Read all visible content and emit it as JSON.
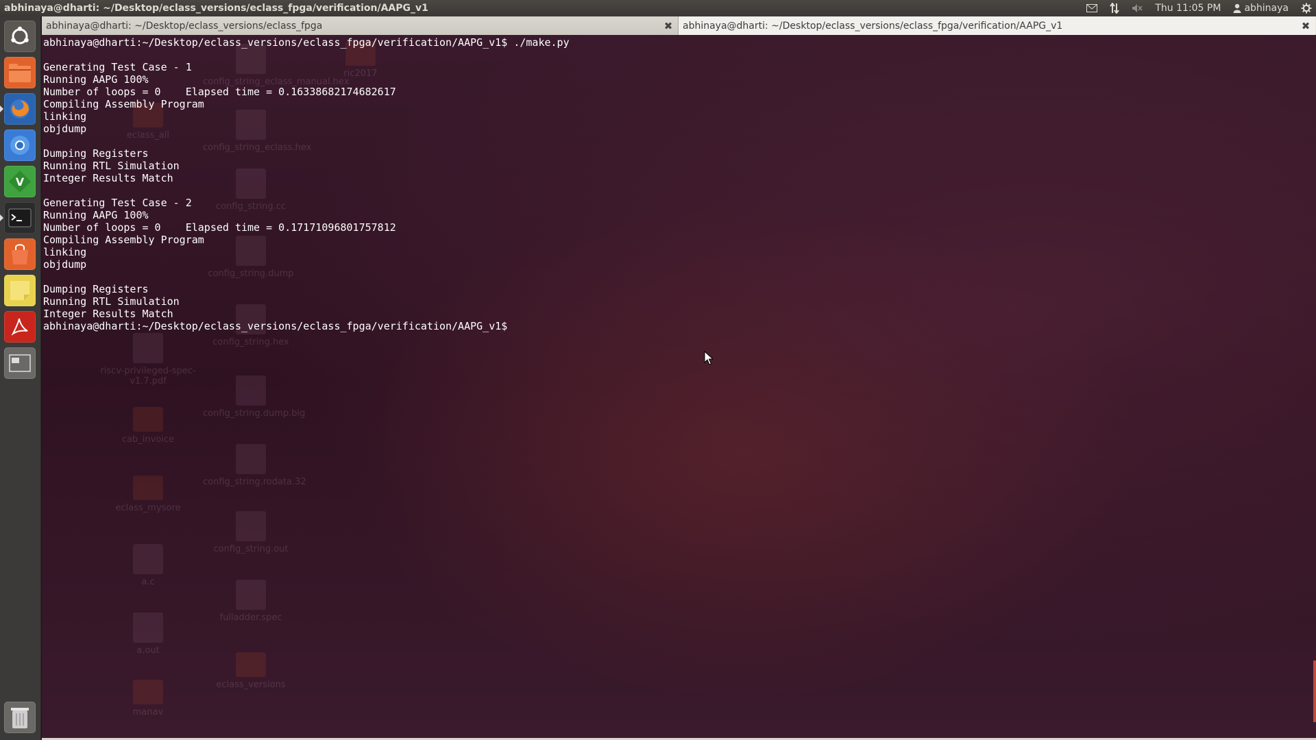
{
  "window": {
    "title": "abhinaya@dharti: ~/Desktop/eclass_versions/eclass_fpga/verification/AAPG_v1"
  },
  "panel": {
    "indicators": {
      "mail_icon": "envelope-icon",
      "network_icon": "network-arrows-icon",
      "sound_icon": "speaker-muted-icon",
      "clock": "Thu 11:05 PM",
      "user_icon": "person-icon",
      "user": "abhinaya",
      "session_icon": "gear-icon"
    }
  },
  "launcher": {
    "items": [
      {
        "name": "dash-home",
        "icon": "ubuntu-logo-icon",
        "color": "#5b5854"
      },
      {
        "name": "files",
        "icon": "file-manager-icon",
        "color": "#e2622c"
      },
      {
        "name": "firefox",
        "icon": "firefox-icon",
        "color": "#2a64b0"
      },
      {
        "name": "chromium",
        "icon": "chromium-icon",
        "color": "#3a7bd5"
      },
      {
        "name": "vim",
        "icon": "vim-icon",
        "color": "#3fa33f"
      },
      {
        "name": "terminal",
        "icon": "terminal-icon",
        "color": "#2b2b2b"
      },
      {
        "name": "software-center",
        "icon": "shopping-bag-icon",
        "color": "#e2622c"
      },
      {
        "name": "notes",
        "icon": "sticky-note-icon",
        "color": "#e9d34e"
      },
      {
        "name": "pdf-reader",
        "icon": "acrobat-icon",
        "color": "#c8261d"
      },
      {
        "name": "workspace-switcher",
        "icon": "workspace-icon",
        "color": "#6a6965"
      },
      {
        "name": "trash",
        "icon": "trash-icon",
        "color": "#6a6965"
      }
    ]
  },
  "tabs": [
    {
      "label": "abhinaya@dharti: ~/Desktop/eclass_versions/eclass_fpga",
      "close": "✖"
    },
    {
      "label": "abhinaya@dharti: ~/Desktop/eclass_versions/eclass_fpga/verification/AAPG_v1",
      "close": "✖"
    }
  ],
  "console": {
    "lines": [
      "abhinaya@dharti:~/Desktop/eclass_versions/eclass_fpga/verification/AAPG_v1$ ./make.py",
      "",
      "Generating Test Case - 1",
      "Running AAPG 100%",
      "Number of loops = 0    Elapsed time = 0.16338682174682617",
      "Compiling Assembly Program",
      "linking",
      "objdump",
      "",
      "Dumping Registers",
      "Running RTL Simulation",
      "Integer Results Match",
      "",
      "Generating Test Case - 2",
      "Running AAPG 100%",
      "Number of loops = 0    Elapsed time = 0.17171096801757812",
      "Compiling Assembly Program",
      "linking",
      "objdump",
      "",
      "Dumping Registers",
      "Running RTL Simulation",
      "Integer Results Match",
      "abhinaya@dharti:~/Desktop/eclass_versions/eclass_fpga/verification/AAPG_v1$ "
    ]
  },
  "desktop_icons": [
    {
      "label": "ric2017",
      "type": "folder"
    },
    {
      "label": "config_string_eclass_manual.hex",
      "type": "file"
    },
    {
      "label": "eclass_all",
      "type": "folder"
    },
    {
      "label": "config_string_eclass.hex",
      "type": "file"
    },
    {
      "label": "config_string.cc",
      "type": "file"
    },
    {
      "label": "config_string.dump",
      "type": "file"
    },
    {
      "label": "config_string.hex",
      "type": "file"
    },
    {
      "label": "riscv-privileged-spec-v1.7.pdf",
      "type": "file"
    },
    {
      "label": "config_string.dump.big",
      "type": "file"
    },
    {
      "label": "cab_invoice",
      "type": "folder"
    },
    {
      "label": "config_string.rodata.32",
      "type": "file"
    },
    {
      "label": "eclass_mysore",
      "type": "folder"
    },
    {
      "label": "config_string.out",
      "type": "file"
    },
    {
      "label": "a.c",
      "type": "file"
    },
    {
      "label": "fulladder.spec",
      "type": "file"
    },
    {
      "label": "a.out",
      "type": "file"
    },
    {
      "label": "eclass_versions",
      "type": "folder"
    },
    {
      "label": "manav",
      "type": "folder"
    }
  ]
}
